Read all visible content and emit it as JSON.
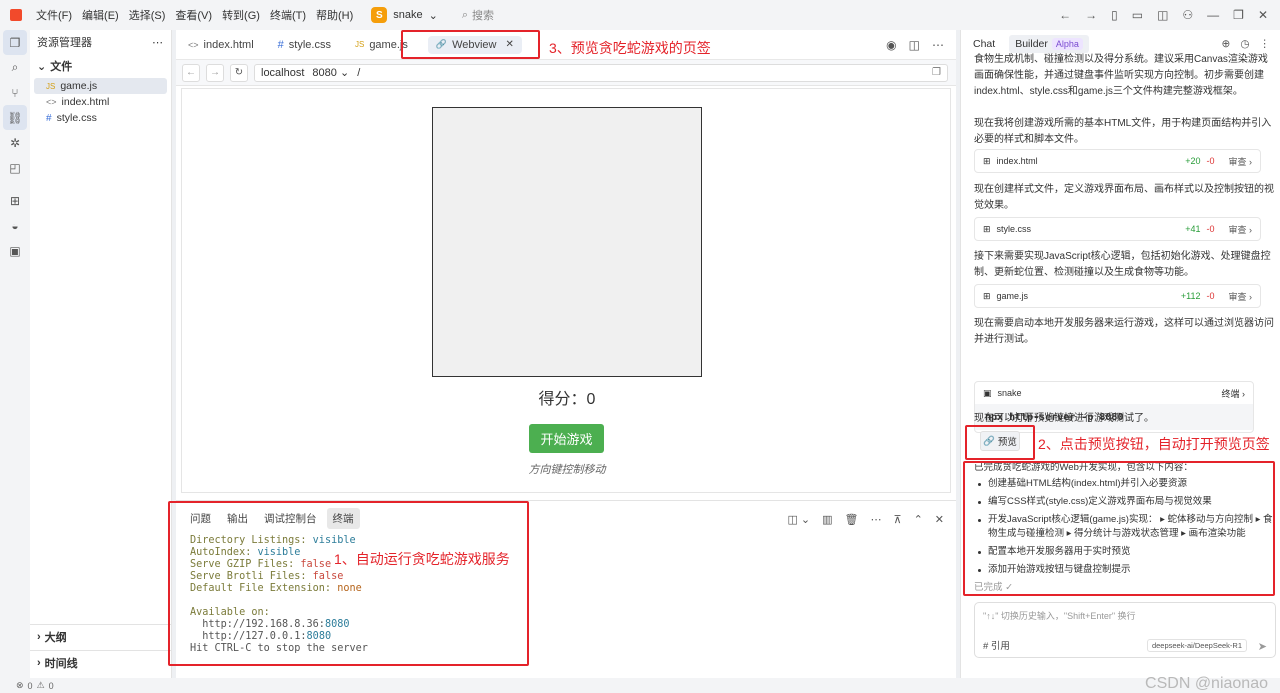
{
  "titlebar": {
    "menus": [
      "文件(F)",
      "编辑(E)",
      "选择(S)",
      "查看(V)",
      "转到(G)",
      "终端(T)",
      "帮助(H)"
    ],
    "project_initial": "S",
    "project_name": "snake",
    "search_placeholder": "搜索"
  },
  "explorer": {
    "title": "资源管理器",
    "section": "文件",
    "files": [
      {
        "name": "game.js",
        "icon": "JS",
        "selected": true
      },
      {
        "name": "index.html",
        "icon": "<>",
        "selected": false
      },
      {
        "name": "style.css",
        "icon": "#",
        "selected": false
      }
    ],
    "outline": "大纲",
    "timeline": "时间线"
  },
  "editor": {
    "tabs": [
      {
        "label": "index.html",
        "icon": "<>"
      },
      {
        "label": "style.css",
        "icon": "#"
      },
      {
        "label": "game.js",
        "icon": "JS"
      },
      {
        "label": "Webview",
        "icon": "🔗"
      }
    ],
    "url_host": "localhost",
    "url_port": "8080",
    "url_path": "/"
  },
  "game": {
    "score_text": "得分：0",
    "start_button": "开始游戏",
    "hint": "方向键控制移动"
  },
  "panel": {
    "tabs": [
      "问题",
      "输出",
      "调试控制台",
      "终端"
    ],
    "active_tab": "终端"
  },
  "terminal": {
    "lines": [
      {
        "key": "Directory Listings: ",
        "val": "visible",
        "cls": "tv"
      },
      {
        "key": "AutoIndex: ",
        "val": "visible",
        "cls": "tv"
      },
      {
        "key": "Serve GZIP Files: ",
        "val": "false",
        "cls": "tf"
      },
      {
        "key": "Serve Brotli Files: ",
        "val": "false",
        "cls": "tf"
      },
      {
        "key": "Default File Extension: ",
        "val": "none",
        "cls": "tn"
      }
    ],
    "available": "Available on:",
    "addr1_host": "  http://192.168.8.36:",
    "addr1_port": "8080",
    "addr2_host": "  http://127.0.0.1:",
    "addr2_port": "8080",
    "stop": "Hit CTRL-C to stop the server"
  },
  "chat": {
    "tab_chat": "Chat",
    "tab_builder": "Builder",
    "alpha_badge": "Alpha",
    "intro": "食物生成机制、碰撞检测以及得分系统。建议采用Canvas渲染游戏画面确保性能，并通过键盘事件监听实现方向控制。初步需要创建index.html、style.css和game.js三个文件构建完整游戏框架。",
    "p1": "现在我将创建游戏所需的基本HTML文件，用于构建页面结构并引入必要的样式和脚本文件。",
    "p2": "现在创建样式文件，定义游戏界面布局、画布样式以及控制按钮的视觉效果。",
    "p3": "接下来需要实现JavaScript核心逻辑，包括初始化游戏、处理键盘控制、更新蛇位置、检测碰撞以及生成食物等功能。",
    "p4": "现在需要启动本地开发服务器来运行游戏，这样可以通过浏览器访问并进行测试。",
    "p5": "现在可以打开预览链接进行游戏测试了。",
    "files": [
      {
        "name": "index.html",
        "add": "+20",
        "del": "-0",
        "review": "审查"
      },
      {
        "name": "style.css",
        "add": "+41",
        "del": "-0",
        "review": "审查"
      },
      {
        "name": "game.js",
        "add": "+112",
        "del": "-0",
        "review": "审查"
      }
    ],
    "terminal_card": {
      "name": "snake",
      "action": "终端",
      "command": "npx http-server -p 8080"
    },
    "preview_button": "预览",
    "summary_title": "已完成贪吃蛇游戏的Web开发实现，包含以下内容：",
    "summary_items": [
      "创建基础HTML结构(index.html)并引入必要资源",
      "编写CSS样式(style.css)定义游戏界面布局与视觉效果",
      "开发JavaScript核心逻辑(game.js)实现： ▸ 蛇体移动与方向控制 ▸ 食物生成与碰撞检测 ▸ 得分统计与游戏状态管理 ▸ 画布渲染功能",
      "配置本地开发服务器用于实时预览",
      "添加开始游戏按钮与键盘控制提示"
    ],
    "done": "已完成 ✓",
    "input_placeholder": "\"↑↓\" 切换历史输入，\"Shift+Enter\" 换行",
    "reference": "# 引用",
    "model": "deepseek-ai/DeepSeek-R1"
  },
  "annotations": {
    "note1": "1、自动运行贪吃蛇游戏服务",
    "note2": "2、点击预览按钮，自动打开预览页签",
    "note3": "3、预览贪吃蛇游戏的页签"
  },
  "status": {
    "errors": "0",
    "warnings": "0"
  },
  "watermark": "CSDN @niaonao"
}
